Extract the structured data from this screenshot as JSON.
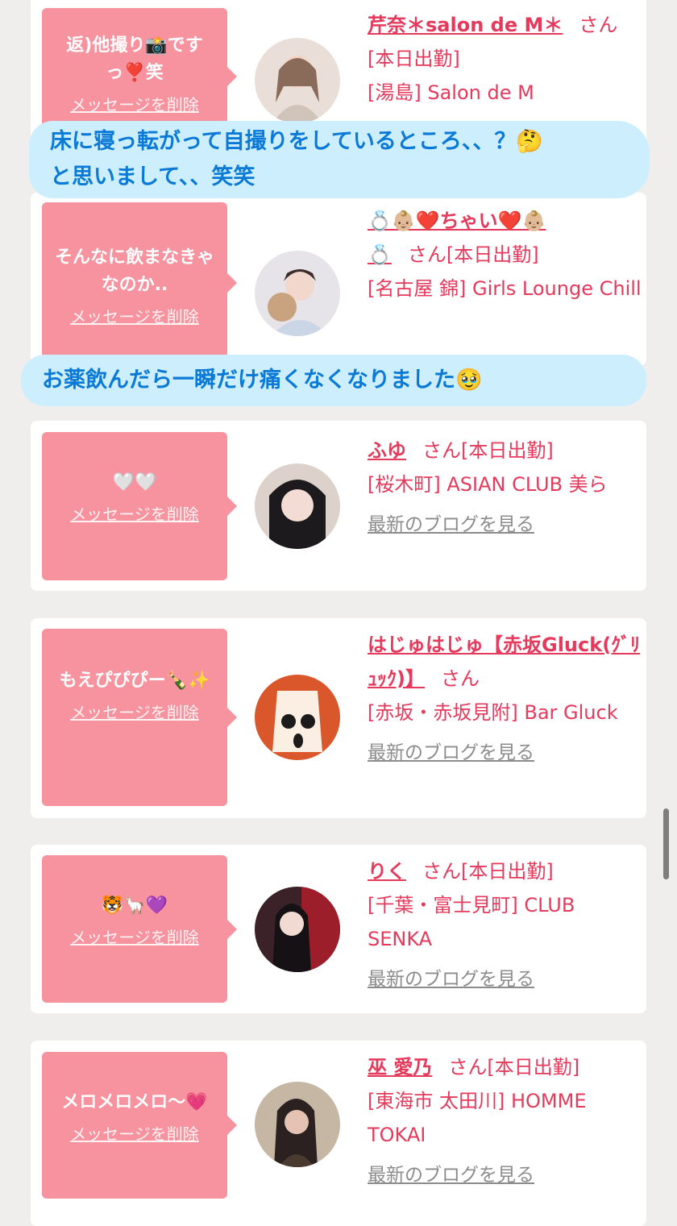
{
  "cards": [
    {
      "message": "返)他撮り📸です っ❣️笑",
      "delete_label": "メッセージを削除",
      "name": "芹奈＊salon de M＊",
      "san": "さん",
      "status": "[本日出勤]",
      "location": "[湯島] Salon de M",
      "blog": ""
    },
    {
      "message": "そんなに飲まなきゃなのか..",
      "delete_label": "メッセージを削除",
      "name_line1": "💍👶🏼❤️ちゃい❤️👶🏼",
      "name_line2": "💍",
      "san": "さん",
      "status": "[本日出勤]",
      "location": "[名古屋 錦] Girls Lounge Chill",
      "blog": ""
    },
    {
      "message": "🤍🤍",
      "delete_label": "メッセージを削除",
      "name": "ふゆ",
      "san": "さん",
      "status": "[本日出勤]",
      "location": "[桜木町] ASIAN CLUB 美ら",
      "blog": "最新のブログを見る"
    },
    {
      "message": "もえぴぴぴー🍾✨",
      "delete_label": "メッセージを削除",
      "name": "はじゅはじゅ【赤坂Gluck(ｸﾞﾘｭｯｸ)】",
      "san": "さん",
      "status": "",
      "location": "[赤坂・赤坂見附] Bar Gluck",
      "blog": "最新のブログを見る"
    },
    {
      "message": "🐯🦙💜",
      "delete_label": "メッセージを削除",
      "name": "りく",
      "san": "さん",
      "status": "[本日出勤]",
      "location": "[千葉・富士見町] CLUB SENKA",
      "blog": "最新のブログを見る"
    },
    {
      "message": "メロメロメロ〜💗",
      "delete_label": "メッセージを削除",
      "name": "巫 愛乃",
      "san": "さん",
      "status": "[本日出勤]",
      "location": "[東海市 太田川] HOMME TOKAI",
      "blog": "最新のブログを見る"
    }
  ],
  "captions": {
    "caption1_line1": "床に寝っ転がって自撮りをしているところ、、？🤔",
    "caption1_line2": "と思いまして、、笑笑",
    "caption2": "お薬飲んだら一瞬だけ痛くなくなりました🥹"
  },
  "colors": {
    "accent": "#e63a5c",
    "bubble": "#f7929f",
    "caption_bg": "#cdeffd",
    "caption_text": "#0b7ad6"
  }
}
